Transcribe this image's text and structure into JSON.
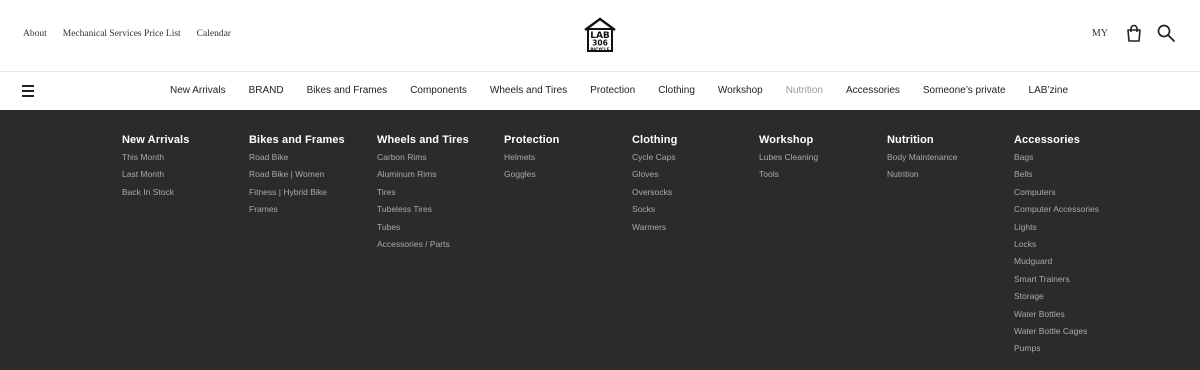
{
  "toplinks": {
    "about": "About",
    "price_list": "Mechanical Services Price List",
    "calendar": "Calendar"
  },
  "logo": {
    "line1": "LAB",
    "line2": "306",
    "line3": "BICYCLE"
  },
  "utils": {
    "my": "MY",
    "cart_icon": "shopping-bag-icon",
    "search_icon": "search-icon"
  },
  "nav": {
    "hamburger_icon": "hamburger-menu-icon",
    "items": [
      {
        "label": "New Arrivals"
      },
      {
        "label": "BRAND"
      },
      {
        "label": "Bikes and Frames"
      },
      {
        "label": "Components"
      },
      {
        "label": "Wheels and Tires"
      },
      {
        "label": "Protection"
      },
      {
        "label": "Clothing"
      },
      {
        "label": "Workshop"
      },
      {
        "label": "Nutrition",
        "state": "hovered"
      },
      {
        "label": "Accessories"
      },
      {
        "label": "Someone’s private"
      },
      {
        "label": "LAB’zine"
      }
    ]
  },
  "mega": {
    "columns": [
      {
        "title": "New Arrivals",
        "links": [
          "This Month",
          "Last Month",
          "Back In Stock"
        ]
      },
      {
        "title": "Bikes and Frames",
        "links": [
          "Road Bike",
          "Road Bike | Women",
          "Fitness | Hybrid Bike",
          "Frames"
        ]
      },
      {
        "title": "Wheels and Tires",
        "links": [
          "Carbon Rims",
          "Aluminum Rims",
          "Tires",
          "Tubeless Tires",
          "Tubes",
          "Accessories / Parts"
        ]
      },
      {
        "title": "Protection",
        "links": [
          "Helmets",
          "Goggles"
        ]
      },
      {
        "title": "Clothing",
        "links": [
          "Cycle Caps",
          "Gloves",
          "Oversocks",
          "Socks",
          "Warmers"
        ]
      },
      {
        "title": "Workshop",
        "links": [
          "Lubes Cleaning",
          "Tools"
        ]
      },
      {
        "title": "Nutrition",
        "links": [
          "Body Maintenance",
          "Nutrition"
        ]
      },
      {
        "title": "Accessories",
        "links": [
          "Bags",
          "Bells",
          "Computers",
          "Computer Accessories",
          "Lights",
          "Locks",
          "Mudguard",
          "Smart Trainers",
          "Storage",
          "Water Bottles",
          "Water Bottle Cages",
          "Pumps"
        ]
      }
    ]
  },
  "colors": {
    "menu_bg": "#2b2b2b",
    "menu_title": "#ffffff",
    "menu_link": "#a9a9a9",
    "nav_muted": "#9a9a9a"
  }
}
